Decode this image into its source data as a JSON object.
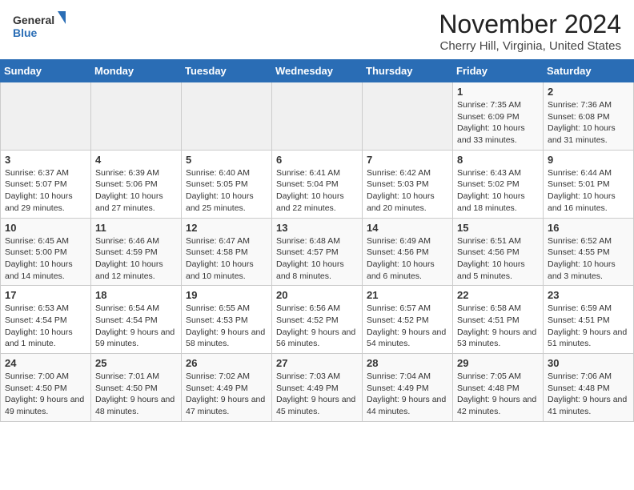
{
  "header": {
    "logo_general": "General",
    "logo_blue": "Blue",
    "month_title": "November 2024",
    "location": "Cherry Hill, Virginia, United States"
  },
  "weekdays": [
    "Sunday",
    "Monday",
    "Tuesday",
    "Wednesday",
    "Thursday",
    "Friday",
    "Saturday"
  ],
  "weeks": [
    [
      {
        "day": "",
        "empty": true
      },
      {
        "day": "",
        "empty": true
      },
      {
        "day": "",
        "empty": true
      },
      {
        "day": "",
        "empty": true
      },
      {
        "day": "",
        "empty": true
      },
      {
        "day": "1",
        "sunrise": "Sunrise: 7:35 AM",
        "sunset": "Sunset: 6:09 PM",
        "daylight": "Daylight: 10 hours and 33 minutes."
      },
      {
        "day": "2",
        "sunrise": "Sunrise: 7:36 AM",
        "sunset": "Sunset: 6:08 PM",
        "daylight": "Daylight: 10 hours and 31 minutes."
      }
    ],
    [
      {
        "day": "3",
        "sunrise": "Sunrise: 6:37 AM",
        "sunset": "Sunset: 5:07 PM",
        "daylight": "Daylight: 10 hours and 29 minutes."
      },
      {
        "day": "4",
        "sunrise": "Sunrise: 6:39 AM",
        "sunset": "Sunset: 5:06 PM",
        "daylight": "Daylight: 10 hours and 27 minutes."
      },
      {
        "day": "5",
        "sunrise": "Sunrise: 6:40 AM",
        "sunset": "Sunset: 5:05 PM",
        "daylight": "Daylight: 10 hours and 25 minutes."
      },
      {
        "day": "6",
        "sunrise": "Sunrise: 6:41 AM",
        "sunset": "Sunset: 5:04 PM",
        "daylight": "Daylight: 10 hours and 22 minutes."
      },
      {
        "day": "7",
        "sunrise": "Sunrise: 6:42 AM",
        "sunset": "Sunset: 5:03 PM",
        "daylight": "Daylight: 10 hours and 20 minutes."
      },
      {
        "day": "8",
        "sunrise": "Sunrise: 6:43 AM",
        "sunset": "Sunset: 5:02 PM",
        "daylight": "Daylight: 10 hours and 18 minutes."
      },
      {
        "day": "9",
        "sunrise": "Sunrise: 6:44 AM",
        "sunset": "Sunset: 5:01 PM",
        "daylight": "Daylight: 10 hours and 16 minutes."
      }
    ],
    [
      {
        "day": "10",
        "sunrise": "Sunrise: 6:45 AM",
        "sunset": "Sunset: 5:00 PM",
        "daylight": "Daylight: 10 hours and 14 minutes."
      },
      {
        "day": "11",
        "sunrise": "Sunrise: 6:46 AM",
        "sunset": "Sunset: 4:59 PM",
        "daylight": "Daylight: 10 hours and 12 minutes."
      },
      {
        "day": "12",
        "sunrise": "Sunrise: 6:47 AM",
        "sunset": "Sunset: 4:58 PM",
        "daylight": "Daylight: 10 hours and 10 minutes."
      },
      {
        "day": "13",
        "sunrise": "Sunrise: 6:48 AM",
        "sunset": "Sunset: 4:57 PM",
        "daylight": "Daylight: 10 hours and 8 minutes."
      },
      {
        "day": "14",
        "sunrise": "Sunrise: 6:49 AM",
        "sunset": "Sunset: 4:56 PM",
        "daylight": "Daylight: 10 hours and 6 minutes."
      },
      {
        "day": "15",
        "sunrise": "Sunrise: 6:51 AM",
        "sunset": "Sunset: 4:56 PM",
        "daylight": "Daylight: 10 hours and 5 minutes."
      },
      {
        "day": "16",
        "sunrise": "Sunrise: 6:52 AM",
        "sunset": "Sunset: 4:55 PM",
        "daylight": "Daylight: 10 hours and 3 minutes."
      }
    ],
    [
      {
        "day": "17",
        "sunrise": "Sunrise: 6:53 AM",
        "sunset": "Sunset: 4:54 PM",
        "daylight": "Daylight: 10 hours and 1 minute."
      },
      {
        "day": "18",
        "sunrise": "Sunrise: 6:54 AM",
        "sunset": "Sunset: 4:54 PM",
        "daylight": "Daylight: 9 hours and 59 minutes."
      },
      {
        "day": "19",
        "sunrise": "Sunrise: 6:55 AM",
        "sunset": "Sunset: 4:53 PM",
        "daylight": "Daylight: 9 hours and 58 minutes."
      },
      {
        "day": "20",
        "sunrise": "Sunrise: 6:56 AM",
        "sunset": "Sunset: 4:52 PM",
        "daylight": "Daylight: 9 hours and 56 minutes."
      },
      {
        "day": "21",
        "sunrise": "Sunrise: 6:57 AM",
        "sunset": "Sunset: 4:52 PM",
        "daylight": "Daylight: 9 hours and 54 minutes."
      },
      {
        "day": "22",
        "sunrise": "Sunrise: 6:58 AM",
        "sunset": "Sunset: 4:51 PM",
        "daylight": "Daylight: 9 hours and 53 minutes."
      },
      {
        "day": "23",
        "sunrise": "Sunrise: 6:59 AM",
        "sunset": "Sunset: 4:51 PM",
        "daylight": "Daylight: 9 hours and 51 minutes."
      }
    ],
    [
      {
        "day": "24",
        "sunrise": "Sunrise: 7:00 AM",
        "sunset": "Sunset: 4:50 PM",
        "daylight": "Daylight: 9 hours and 49 minutes."
      },
      {
        "day": "25",
        "sunrise": "Sunrise: 7:01 AM",
        "sunset": "Sunset: 4:50 PM",
        "daylight": "Daylight: 9 hours and 48 minutes."
      },
      {
        "day": "26",
        "sunrise": "Sunrise: 7:02 AM",
        "sunset": "Sunset: 4:49 PM",
        "daylight": "Daylight: 9 hours and 47 minutes."
      },
      {
        "day": "27",
        "sunrise": "Sunrise: 7:03 AM",
        "sunset": "Sunset: 4:49 PM",
        "daylight": "Daylight: 9 hours and 45 minutes."
      },
      {
        "day": "28",
        "sunrise": "Sunrise: 7:04 AM",
        "sunset": "Sunset: 4:49 PM",
        "daylight": "Daylight: 9 hours and 44 minutes."
      },
      {
        "day": "29",
        "sunrise": "Sunrise: 7:05 AM",
        "sunset": "Sunset: 4:48 PM",
        "daylight": "Daylight: 9 hours and 42 minutes."
      },
      {
        "day": "30",
        "sunrise": "Sunrise: 7:06 AM",
        "sunset": "Sunset: 4:48 PM",
        "daylight": "Daylight: 9 hours and 41 minutes."
      }
    ]
  ]
}
